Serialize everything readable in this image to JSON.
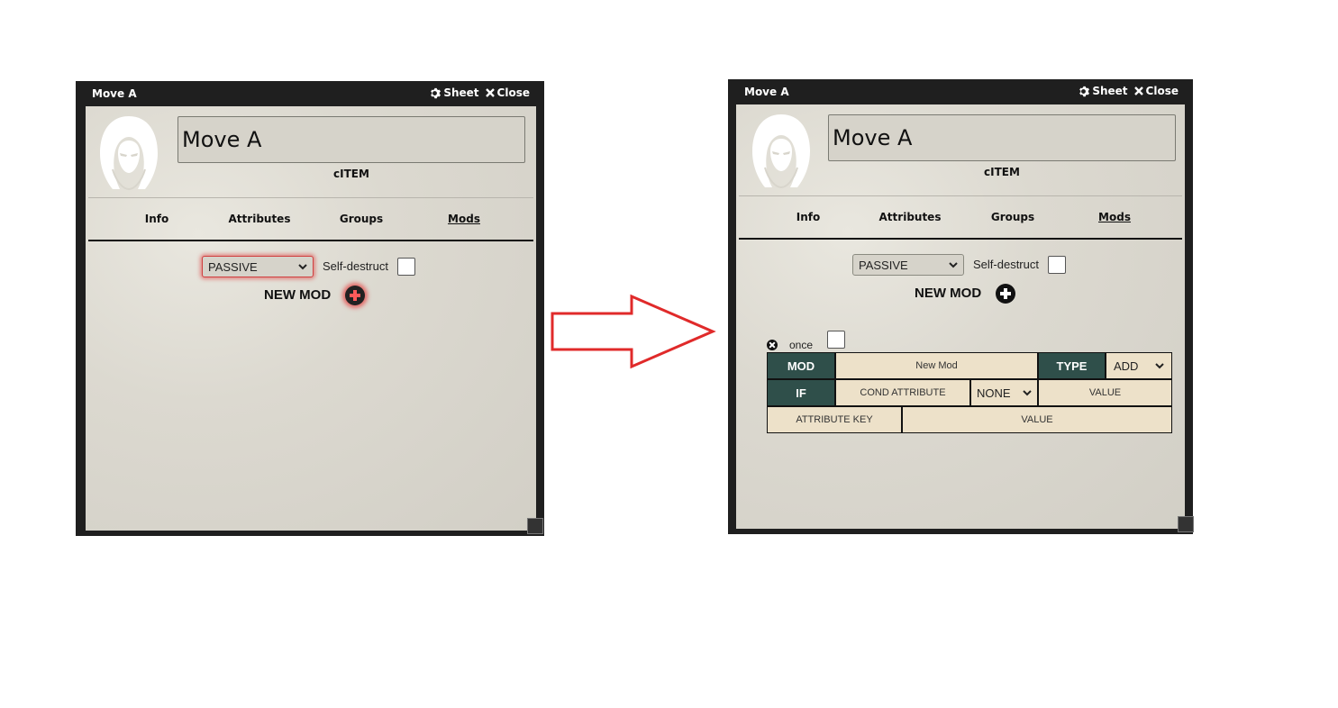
{
  "windows": [
    {
      "title": "Move A",
      "sheet_label": "Sheet",
      "close_label": "Close",
      "name_value": "Move A",
      "subtype": "cITEM",
      "tabs": [
        "Info",
        "Attributes",
        "Groups",
        "Mods"
      ],
      "active_tab": "Mods",
      "mode_select": "PASSIVE",
      "self_destruct_label": "Self-destruct",
      "new_mod_label": "NEW MOD"
    },
    {
      "title": "Move A",
      "sheet_label": "Sheet",
      "close_label": "Close",
      "name_value": "Move A",
      "subtype": "cITEM",
      "tabs": [
        "Info",
        "Attributes",
        "Groups",
        "Mods"
      ],
      "active_tab": "Mods",
      "mode_select": "PASSIVE",
      "self_destruct_label": "Self-destruct",
      "new_mod_label": "NEW MOD",
      "mod": {
        "once_label": "once",
        "mod_label": "MOD",
        "mod_name": "New Mod",
        "type_label": "TYPE",
        "type_value": "ADD",
        "if_label": "IF",
        "cond_attribute_placeholder": "COND ATTRIBUTE",
        "cond_operator": "NONE",
        "cond_value_placeholder": "VALUE",
        "attribute_key_placeholder": "ATTRIBUTE KEY",
        "value_placeholder": "VALUE"
      }
    }
  ],
  "colors": {
    "arrow": "#e02a2a",
    "header_cell": "#2f4f4a",
    "input_cell": "#ede1c9",
    "window_frame": "#1f1f1f"
  }
}
